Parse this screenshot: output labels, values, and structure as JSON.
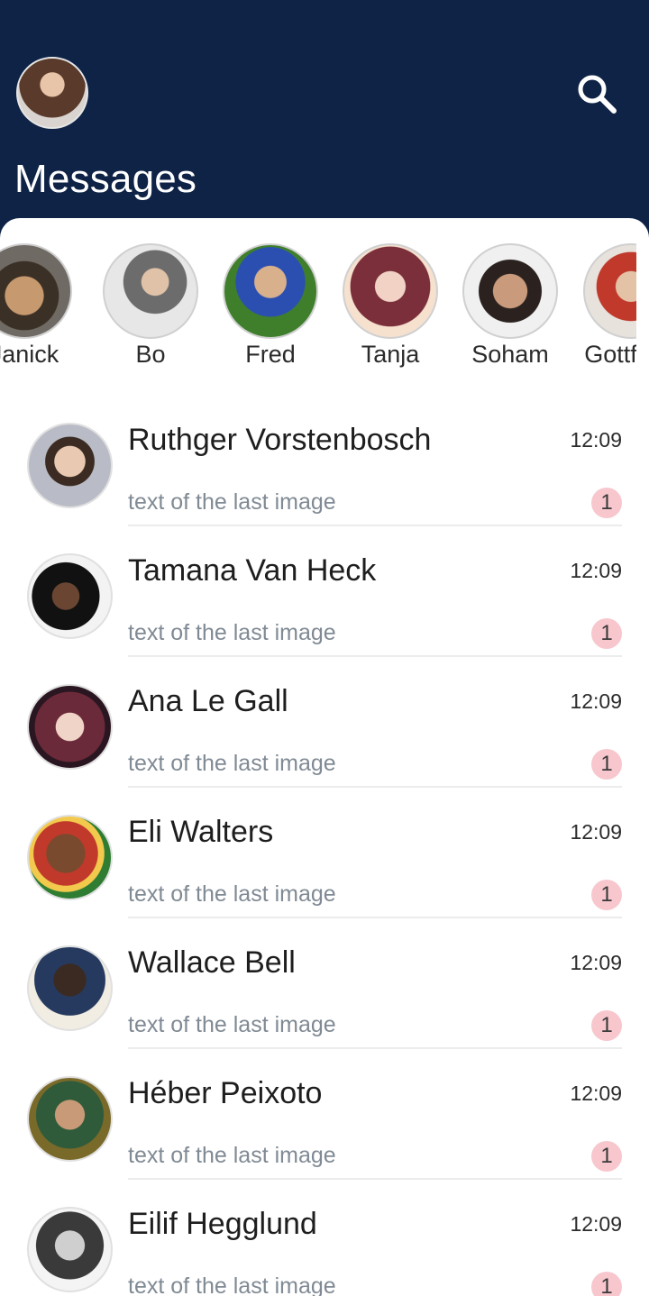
{
  "header": {
    "title": "Messages"
  },
  "stories": [
    {
      "name": "Janick"
    },
    {
      "name": "Bo"
    },
    {
      "name": "Fred"
    },
    {
      "name": "Tanja"
    },
    {
      "name": "Soham"
    },
    {
      "name": "Gottfried"
    }
  ],
  "chats": [
    {
      "name": "Ruthger Vorstenbosch",
      "time": "12:09",
      "preview": "text of the last image",
      "unread": "1"
    },
    {
      "name": "Tamana Van Heck",
      "time": "12:09",
      "preview": "text of the last image",
      "unread": "1"
    },
    {
      "name": "Ana Le Gall",
      "time": "12:09",
      "preview": "text of the last image",
      "unread": "1"
    },
    {
      "name": "Eli Walters",
      "time": "12:09",
      "preview": "text of the last image",
      "unread": "1"
    },
    {
      "name": "Wallace Bell",
      "time": "12:09",
      "preview": "text of the last image",
      "unread": "1"
    },
    {
      "name": "Héber Peixoto",
      "time": "12:09",
      "preview": "text of the last image",
      "unread": "1"
    },
    {
      "name": "Eilif Hegglund",
      "time": "12:09",
      "preview": "text of the last image",
      "unread": "1"
    }
  ],
  "colors": {
    "header_bg": "#0e2346",
    "badge_bg": "#f7c7cd",
    "preview_text": "#808a94"
  },
  "icons": {
    "search": "search-icon"
  }
}
